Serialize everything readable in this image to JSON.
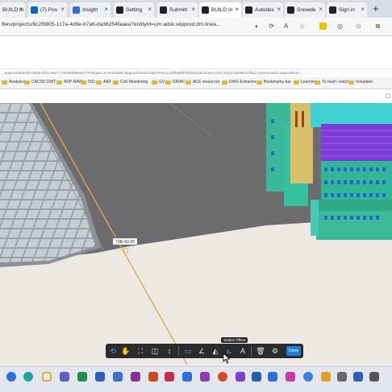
{
  "browser": {
    "tabs": [
      {
        "label": "BUILD In",
        "color": "#3b6fd8"
      },
      {
        "label": "(7) Pos",
        "color": "#0a66c2"
      },
      {
        "label": "Insight",
        "color": "#2a6fdb"
      },
      {
        "label": "Setting",
        "color": "#222222"
      },
      {
        "label": "Submitt",
        "color": "#222222"
      },
      {
        "label": "BUILD In",
        "color": "#222222"
      },
      {
        "label": "Autodes",
        "color": "#222222"
      },
      {
        "label": "Snowde",
        "color": "#222222"
      },
      {
        "label": "Sign in",
        "color": "#222222"
      }
    ],
    "new_tab": "+",
    "url": "files/projects/6c2f9805-1c7a-4d9e-b7a6-da36254faaea?entityId=urn:adsk.wipprod:dm.linea...",
    "inner_url": "...projects/6ebe2f4-b53b-4f15-a617-7320d60b8e6e/7?entityId=urn%3Aadsk.wipprod%3Afs.folder%3Aco.09fbd80f7bf03a1fc6c4cbe%3Afs.XQQC5pe8lem/filed=urn%3Aadsk.wipprod%3A...",
    "bookmarks": [
      "Analytics",
      "CACSD DWT",
      "ADP RAW",
      "ISO",
      "AIM",
      "Civil Monitoring",
      "GV",
      "IDRAC",
      "ACE resources",
      "DWG Extractor",
      "Bookmarks bar",
      "Learning",
      "To read / watch",
      "Volunteer"
    ]
  },
  "viewer": {
    "measurement_label": "738+50.00",
    "tooltip": "Station Offset",
    "done_label": "Done",
    "toolbar_icons": [
      "orbit-icon",
      "pan-icon",
      "fit-view-icon",
      "section-box-icon",
      "walk-icon",
      "measure-distance-icon",
      "measure-angle-icon",
      "measure-slope-icon",
      "station-offset-icon",
      "text-markup-icon",
      "delete-icon",
      "settings-icon"
    ],
    "colors": {
      "ground": "#ece8e2",
      "road": "#6e6e70",
      "building": "#3fb89a",
      "alignment": "#f0a040",
      "roof": "#8a4ad8"
    }
  },
  "taskbar": {
    "apps": [
      "windows-icon",
      "edge-icon",
      "chrome-icon",
      "teams-icon",
      "excel-icon",
      "word-icon",
      "word2-icon",
      "onenote-icon",
      "powerpoint-icon",
      "onedrive-icon",
      "outlook-icon",
      "vs-icon",
      "chrome2-icon",
      "camera-icon",
      "outlook2-icon",
      "wall-icon",
      "powerpoint2-icon",
      "edge2-icon",
      "sticky-icon",
      "calc-icon",
      "word3-icon",
      "snip-icon"
    ]
  }
}
